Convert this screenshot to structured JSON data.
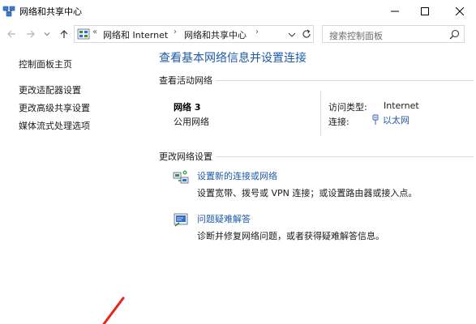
{
  "window": {
    "title": "网络和共享中心"
  },
  "nav": {
    "breadcrumb_prefix": "«",
    "crumbs": [
      "网络和 Internet",
      "网络和共享中心"
    ],
    "search_placeholder": "搜索控制面板"
  },
  "sidebar": {
    "items": [
      {
        "label": "控制面板主页"
      },
      {
        "label": "更改适配器设置"
      },
      {
        "label": "更改高级共享设置"
      },
      {
        "label": "媒体流式处理选项"
      }
    ]
  },
  "main": {
    "title": "查看基本网络信息并设置连接",
    "active_networks_heading": "查看活动网络",
    "network": {
      "name": "网络 3",
      "category": "公用网络",
      "access_type_label": "访问类型:",
      "access_type_value": "Internet",
      "connections_label": "连接:",
      "connections_value": "以太网"
    },
    "change_settings_heading": "更改网络设置",
    "tasks": [
      {
        "link": "设置新的连接或网络",
        "desc": "设置宽带、拨号或 VPN 连接；或设置路由器或接入点。",
        "icon": "network-setup-icon"
      },
      {
        "link": "问题疑难解答",
        "desc": "诊断并修复网络问题，或者获得疑难解答信息。",
        "icon": "troubleshoot-icon"
      }
    ]
  },
  "colors": {
    "link": "#1e5aa8",
    "divider": "#d6dbe9",
    "annotation": "#e8261e"
  }
}
